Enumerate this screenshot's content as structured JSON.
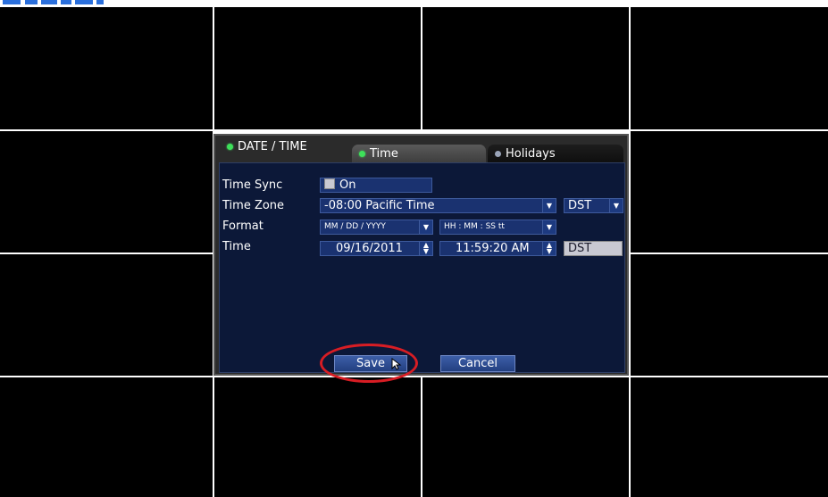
{
  "dialog": {
    "title": "DATE / TIME",
    "tabs": [
      {
        "label": "Time",
        "active": true
      },
      {
        "label": "Holidays",
        "active": false
      }
    ]
  },
  "form": {
    "time_sync": {
      "label": "Time Sync",
      "checkbox_label": "On",
      "checked": false
    },
    "time_zone": {
      "label": "Time Zone",
      "value": "-08:00 Pacific Time",
      "dst_value": "DST"
    },
    "format": {
      "label": "Format",
      "date_format": "MM / DD / YYYY",
      "time_format": "HH : MM : SS tt"
    },
    "time": {
      "label": "Time",
      "date": "09/16/2011",
      "clock": "11:59:20 AM",
      "dst_label": "DST"
    }
  },
  "buttons": {
    "save": "Save",
    "cancel": "Cancel"
  },
  "colors": {
    "panel": "#0c1838",
    "field": "#1a3270",
    "accent_green": "#3ee05a",
    "highlight_ring": "#d81d24"
  },
  "icons": {
    "dropdown": "chevron-down-icon",
    "spinner": "up-down-spinner-icon",
    "cursor": "mouse-pointer-icon",
    "status_dot": "status-dot-icon"
  }
}
